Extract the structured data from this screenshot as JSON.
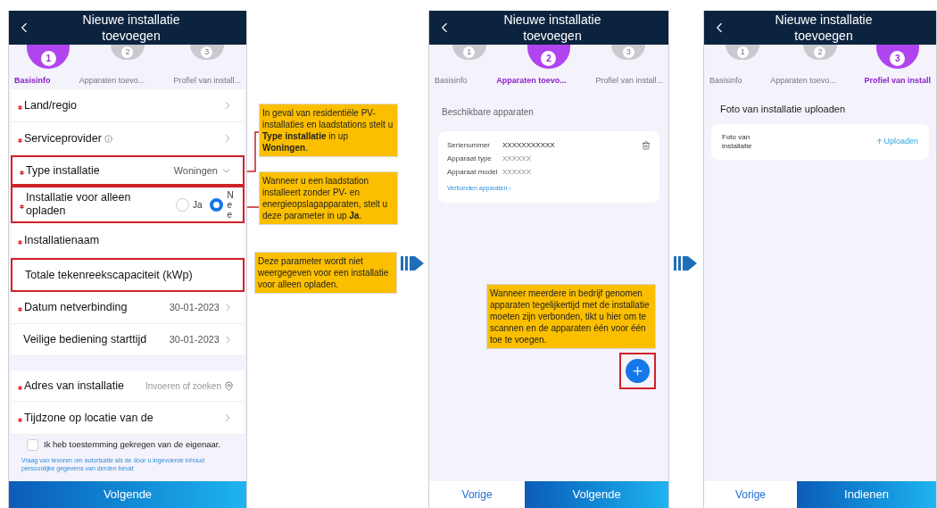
{
  "screens": [
    {
      "kind": "basic",
      "title": "Nieuwe installatie toevoegen",
      "steps": [
        {
          "number": "1",
          "label": "Basisinfo",
          "selected": true
        },
        {
          "number": "2",
          "label": "Apparaten toevo...",
          "selected": false
        },
        {
          "number": "3",
          "label": "Profiel van install...",
          "selected": false
        }
      ],
      "field_groups": [
        [
          {
            "kind": "link",
            "label": "Land/regio",
            "required": true,
            "info": false,
            "highlighted": false
          },
          {
            "kind": "link",
            "label": "Serviceprovider",
            "required": true,
            "info": true,
            "highlighted": false
          },
          {
            "kind": "select",
            "label": "Type installatie",
            "value": "Woningen",
            "required": true,
            "info": false,
            "highlighted": true
          },
          {
            "kind": "radio",
            "label": "Installatie voor alleen opladen",
            "required": true,
            "info": false,
            "highlighted": true,
            "options": [
              {
                "label": "Ja",
                "selected": false
              },
              {
                "label": "Nee",
                "selected": true
              }
            ]
          },
          {
            "kind": "input",
            "label": "Installatienaam",
            "required": true,
            "info": false,
            "highlighted": false
          },
          {
            "kind": "input",
            "label": "Totale tekenreekscapaciteit (kWp)",
            "required": false,
            "info": false,
            "highlighted": true
          },
          {
            "kind": "date",
            "label": "Datum netverbinding",
            "value": "30-01-2023",
            "required": true,
            "info": false,
            "highlighted": false
          },
          {
            "kind": "date",
            "label": "Veilige bediening starttijd",
            "value": "30-01-2023",
            "required": false,
            "info": false,
            "highlighted": false
          }
        ],
        [
          {
            "kind": "address",
            "label": "Adres van installatie",
            "placeholder": "Invoeren of zoeken",
            "required": true,
            "info": false,
            "highlighted": false
          },
          {
            "kind": "link",
            "label": "Tijdzone op locatie van de",
            "required": true,
            "info": false,
            "highlighted": false
          }
        ]
      ],
      "consent": {
        "label": "Ik heb toestemming gekregen van de eigenaar.",
        "checked": false
      },
      "note": "Vraag van tevoren om autorisatie als de door u ingevoerde inhoud persoonlijke gegevens van derden bevat",
      "buttons": [
        {
          "label": "Volgende",
          "kind": "primary"
        }
      ],
      "callouts": [
        "In geval van residentiële PV-installaties en laadstations stelt u **Type installatie** in up **Woningen**.",
        "Wanneer u een laadstation installeert zonder PV- en energieopslagapparaten, stelt u deze parameter in up **Ja**.",
        "Deze parameter wordt niet weergegeven voor een installatie voor alleen opladen."
      ]
    },
    {
      "kind": "devices",
      "title": "Nieuwe installatie toevoegen",
      "steps": [
        {
          "number": "1",
          "label": "Basisinfo",
          "selected": false
        },
        {
          "number": "2",
          "label": "Apparaten toevo...",
          "selected": true
        },
        {
          "number": "3",
          "label": "Profiel van install...",
          "selected": false
        }
      ],
      "section_title": "Beschikbare apparaten",
      "devices": [
        {
          "rows": [
            {
              "label": "Serienummer",
              "value": "XXXXXXXXXXX"
            },
            {
              "label": "Apparaat type",
              "value": "XXXXXX"
            },
            {
              "label": "Apparaat model",
              "value": "XXXXXX"
            }
          ],
          "link": "Verbonden apparaten"
        }
      ],
      "callouts": [
        "Wanneer meerdere in bedrijf genomen apparaten tegelijkertijd met de installatie moeten zijn verbonden, tikt u hier om te scannen en de apparaten één voor één toe te voegen."
      ],
      "fab": {
        "highlighted": true
      },
      "buttons": [
        {
          "label": "Vorige",
          "kind": "secondary"
        },
        {
          "label": "Volgende",
          "kind": "primary"
        }
      ]
    },
    {
      "kind": "profile",
      "title": "Nieuwe installatie toevoegen",
      "steps": [
        {
          "number": "1",
          "label": "Basisinfo",
          "selected": false
        },
        {
          "number": "2",
          "label": "Apparaten toevo...",
          "selected": false
        },
        {
          "number": "3",
          "label": "Profiel van install",
          "selected": true
        }
      ],
      "section_title": "Foto van installatie uploaden",
      "upload": {
        "label": "Foto van installatie",
        "action": "Uploaden"
      },
      "buttons": [
        {
          "label": "Vorige",
          "kind": "secondary"
        },
        {
          "label": "Indienen",
          "kind": "primary"
        }
      ]
    }
  ]
}
